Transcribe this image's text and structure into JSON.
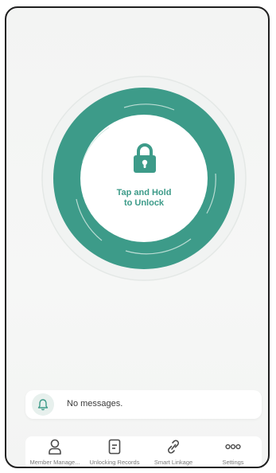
{
  "unlock": {
    "label_line1": "Tap and Hold",
    "label_line2": "to Unlock",
    "accent": "#3d9b89"
  },
  "messages": {
    "text": "No messages."
  },
  "nav": {
    "items": [
      {
        "label": "Member Manage...",
        "icon": "person-icon"
      },
      {
        "label": "Unlocking Records",
        "icon": "records-icon"
      },
      {
        "label": "Smart Linkage",
        "icon": "link-icon"
      },
      {
        "label": "Settings",
        "icon": "more-dots-icon"
      }
    ]
  }
}
